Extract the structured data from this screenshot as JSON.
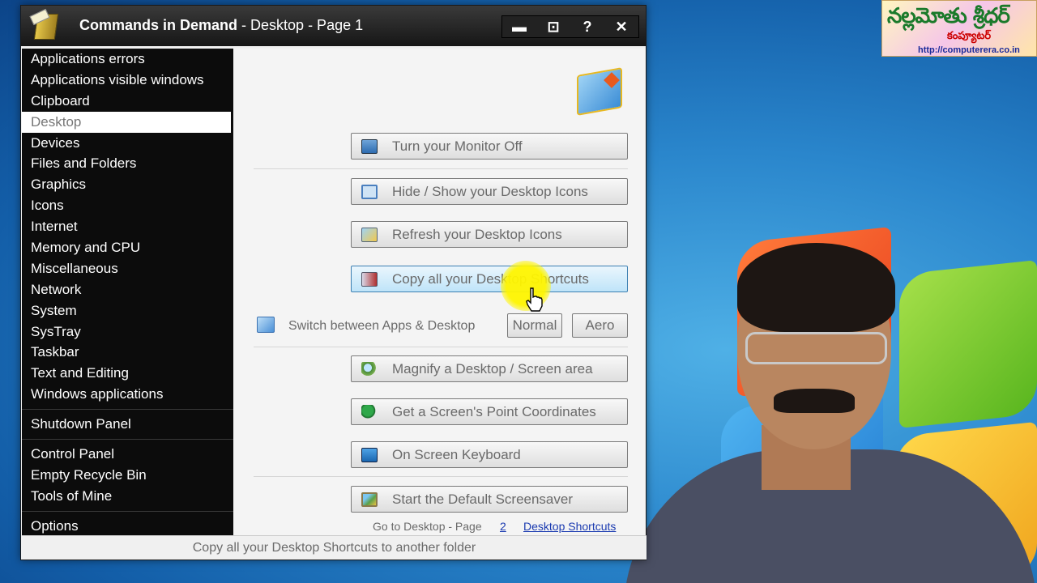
{
  "watermark": {
    "title": "నల్లమోతు శ్రీధర్",
    "subtitle": "కంప్యూటర్",
    "url": "http://computerera.co.in"
  },
  "window": {
    "app_name": "Commands in Demand",
    "separator": " - ",
    "page_title": "Desktop - Page 1",
    "controls": {
      "minimize": "▬",
      "maximize": "⊡",
      "help": "?",
      "close": "✕"
    }
  },
  "sidebar": {
    "group1": [
      "Applications errors",
      "Applications visible windows",
      "Clipboard",
      "Desktop",
      "Devices",
      "Files and Folders",
      "Graphics",
      "Icons",
      "Internet",
      "Memory and CPU",
      "Miscellaneous",
      "Network",
      "System",
      "SysTray",
      "Taskbar",
      "Text and Editing",
      "Windows applications"
    ],
    "active": "Desktop",
    "group2": [
      "Shutdown Panel"
    ],
    "group3": [
      "Control Panel",
      "Empty Recycle Bin",
      "Tools of Mine"
    ],
    "group4": [
      "Options"
    ]
  },
  "commands": {
    "monitor_off": "Turn your Monitor Off",
    "hide_show_icons": "Hide / Show your Desktop Icons",
    "refresh_icons": "Refresh your Desktop Icons",
    "copy_shortcuts": "Copy all your Desktop Shortcuts",
    "switch_label": "Switch between Apps & Desktop",
    "switch_normal": "Normal",
    "switch_aero": "Aero",
    "magnify": "Magnify a Desktop / Screen area",
    "point_coords": "Get a Screen's Point Coordinates",
    "keyboard": "On Screen Keyboard",
    "screensaver": "Start the Default Screensaver"
  },
  "nav": {
    "goto_text": "Go to Desktop - Page",
    "page_link": "2",
    "shortcuts_link": "Desktop Shortcuts"
  },
  "status": {
    "text": "Copy all your Desktop Shortcuts to another folder"
  },
  "colors": {
    "sidebar_bg": "#0c0c0c",
    "hover_accent": "#3c7fb1",
    "link": "#1a3ab0",
    "cursor_highlight": "#fff500"
  }
}
